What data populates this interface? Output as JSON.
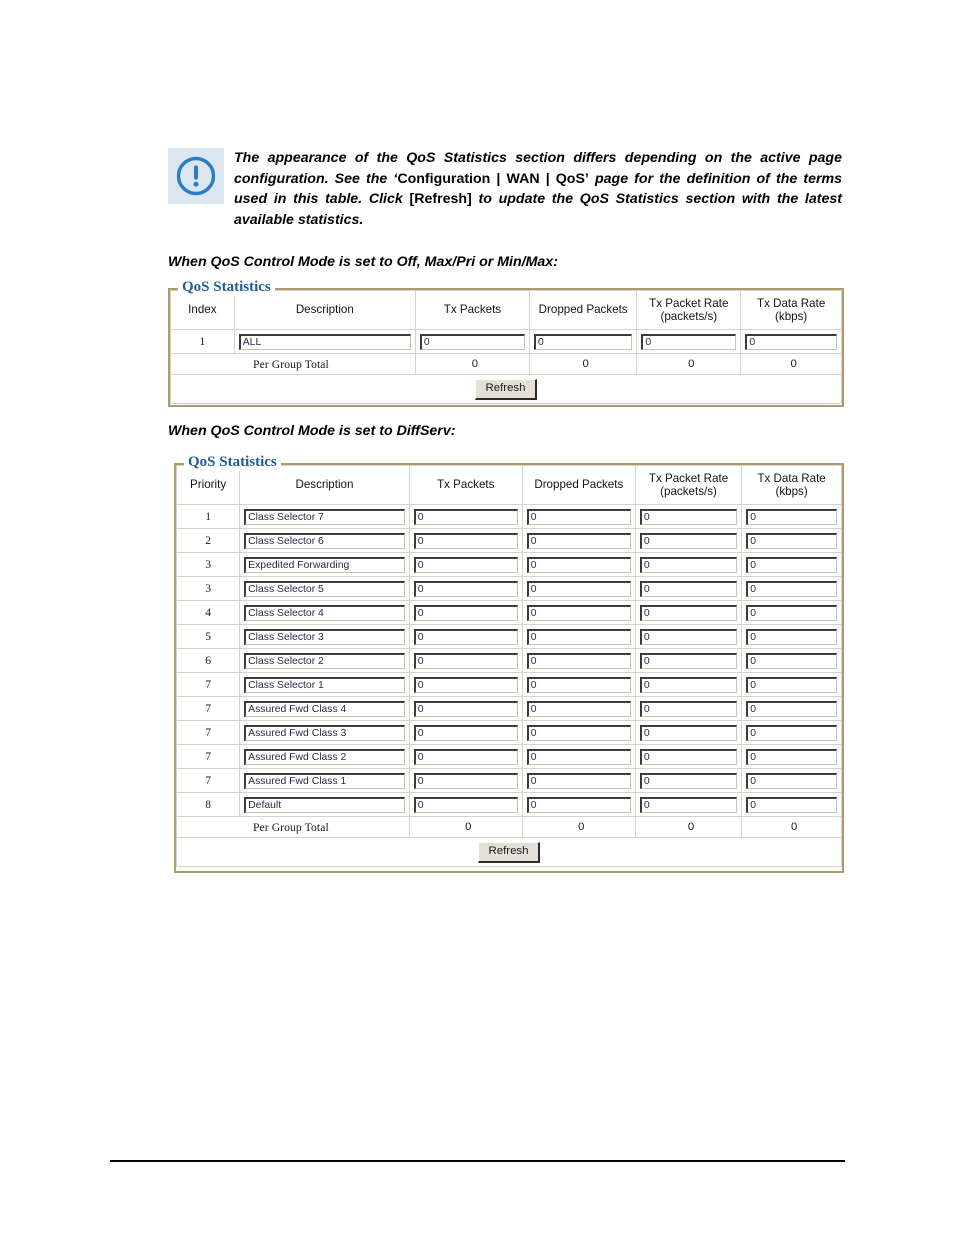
{
  "note": {
    "icon": "exclamation-circle-icon",
    "segments": [
      {
        "text": "The appearance of the QoS Statistics section differs depending on the active page configuration. See the ‘",
        "italic": true
      },
      {
        "text": "Configuration | WAN | QoS’",
        "italic": false
      },
      {
        "text": " page for the definition of the terms used in this table. Click ",
        "italic": true
      },
      {
        "text": "[Refresh]",
        "italic": false
      },
      {
        "text": " to update the QoS Statistics section with the latest available statistics.",
        "italic": true
      }
    ],
    "full_text": "The appearance of the QoS Statistics section differs depending on the active page configuration. See the ‘Configuration | WAN | QoS’ page for the definition of the terms used in this table. Click [Refresh] to update the QoS Statistics section with the latest available statistics."
  },
  "caption_1": "When QoS Control Mode is set to Off, Max/Pri or Min/Max:",
  "caption_2": "When QoS Control Mode is set to DiffServ:",
  "colors": {
    "panel_border": "#b09a6b",
    "legend_text": "#1f5c99",
    "note_icon_bg": "#dce6f1",
    "note_icon_fg": "#2b7cc2",
    "grid_line": "#d7d2c8",
    "button_face": "#e4e0d6"
  },
  "panel_1": {
    "legend": "QoS Statistics",
    "headers": [
      {
        "line1": "Index",
        "line2": ""
      },
      {
        "line1": "Description",
        "line2": ""
      },
      {
        "line1": "Tx Packets",
        "line2": ""
      },
      {
        "line1": "Dropped Packets",
        "line2": ""
      },
      {
        "line1": "Tx Packet Rate",
        "line2": "(packets/s)"
      },
      {
        "line1": "Tx Data Rate",
        "line2": "(kbps)"
      }
    ],
    "rows": [
      {
        "index": "1",
        "description": "ALL",
        "tx_packets": "0",
        "dropped_packets": "0",
        "tx_packet_rate": "0",
        "tx_data_rate": "0"
      }
    ],
    "total_label": "Per Group Total",
    "totals": [
      "0",
      "0",
      "0",
      "0"
    ],
    "refresh_label": "Refresh"
  },
  "panel_2": {
    "legend": "QoS Statistics",
    "headers": [
      {
        "line1": "Priority",
        "line2": ""
      },
      {
        "line1": "Description",
        "line2": ""
      },
      {
        "line1": "Tx Packets",
        "line2": ""
      },
      {
        "line1": "Dropped Packets",
        "line2": ""
      },
      {
        "line1": "Tx Packet Rate",
        "line2": "(packets/s)"
      },
      {
        "line1": "Tx Data Rate",
        "line2": "(kbps)"
      }
    ],
    "rows": [
      {
        "index": "1",
        "description": "Class Selector 7",
        "tx_packets": "0",
        "dropped_packets": "0",
        "tx_packet_rate": "0",
        "tx_data_rate": "0"
      },
      {
        "index": "2",
        "description": "Class Selector 6",
        "tx_packets": "0",
        "dropped_packets": "0",
        "tx_packet_rate": "0",
        "tx_data_rate": "0"
      },
      {
        "index": "3",
        "description": "Expedited Forwarding",
        "tx_packets": "0",
        "dropped_packets": "0",
        "tx_packet_rate": "0",
        "tx_data_rate": "0"
      },
      {
        "index": "3",
        "description": "Class Selector 5",
        "tx_packets": "0",
        "dropped_packets": "0",
        "tx_packet_rate": "0",
        "tx_data_rate": "0"
      },
      {
        "index": "4",
        "description": "Class Selector 4",
        "tx_packets": "0",
        "dropped_packets": "0",
        "tx_packet_rate": "0",
        "tx_data_rate": "0"
      },
      {
        "index": "5",
        "description": "Class Selector 3",
        "tx_packets": "0",
        "dropped_packets": "0",
        "tx_packet_rate": "0",
        "tx_data_rate": "0"
      },
      {
        "index": "6",
        "description": "Class Selector 2",
        "tx_packets": "0",
        "dropped_packets": "0",
        "tx_packet_rate": "0",
        "tx_data_rate": "0"
      },
      {
        "index": "7",
        "description": "Class Selector 1",
        "tx_packets": "0",
        "dropped_packets": "0",
        "tx_packet_rate": "0",
        "tx_data_rate": "0"
      },
      {
        "index": "7",
        "description": "Assured Fwd Class 4",
        "tx_packets": "0",
        "dropped_packets": "0",
        "tx_packet_rate": "0",
        "tx_data_rate": "0"
      },
      {
        "index": "7",
        "description": "Assured Fwd Class 3",
        "tx_packets": "0",
        "dropped_packets": "0",
        "tx_packet_rate": "0",
        "tx_data_rate": "0"
      },
      {
        "index": "7",
        "description": "Assured Fwd Class 2",
        "tx_packets": "0",
        "dropped_packets": "0",
        "tx_packet_rate": "0",
        "tx_data_rate": "0"
      },
      {
        "index": "7",
        "description": "Assured Fwd Class 1",
        "tx_packets": "0",
        "dropped_packets": "0",
        "tx_packet_rate": "0",
        "tx_data_rate": "0"
      },
      {
        "index": "8",
        "description": "Default",
        "tx_packets": "0",
        "dropped_packets": "0",
        "tx_packet_rate": "0",
        "tx_data_rate": "0"
      }
    ],
    "total_label": "Per Group Total",
    "totals": [
      "0",
      "0",
      "0",
      "0"
    ],
    "refresh_label": "Refresh"
  }
}
